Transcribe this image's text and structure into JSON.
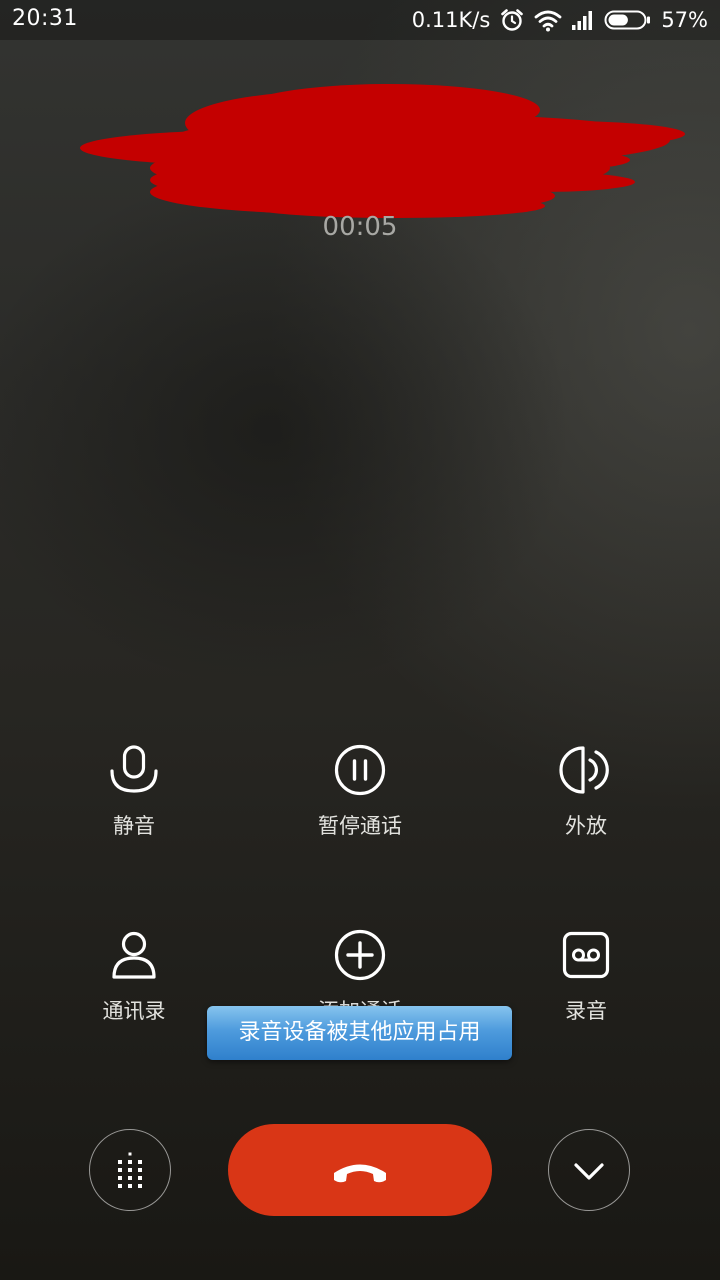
{
  "status_bar": {
    "time": "20:31",
    "network_speed": "0.11K/s",
    "battery_percent": "57%",
    "battery_level": 0.57,
    "icons": [
      "alarm-icon",
      "wifi-icon",
      "signal-icon",
      "battery-icon"
    ]
  },
  "call": {
    "timer": "00:05"
  },
  "controls": [
    {
      "label": "静音",
      "icon": "microphone-icon"
    },
    {
      "label": "暂停通话",
      "icon": "pause-icon"
    },
    {
      "label": "外放",
      "icon": "speaker-icon"
    },
    {
      "label": "通讯录",
      "icon": "contacts-icon"
    },
    {
      "label": "添加通话",
      "icon": "add-call-icon"
    },
    {
      "label": "录音",
      "icon": "record-icon"
    }
  ],
  "toast": {
    "message": "录音设备被其他应用占用"
  },
  "bottom_bar": {
    "dialpad_icon": "dialpad-icon",
    "hangup_icon": "hangup-icon",
    "collapse_icon": "chevron-down-icon"
  },
  "colors": {
    "hangup": "#d93616",
    "toast": "#4e9bdd",
    "redaction": "#c40000"
  }
}
